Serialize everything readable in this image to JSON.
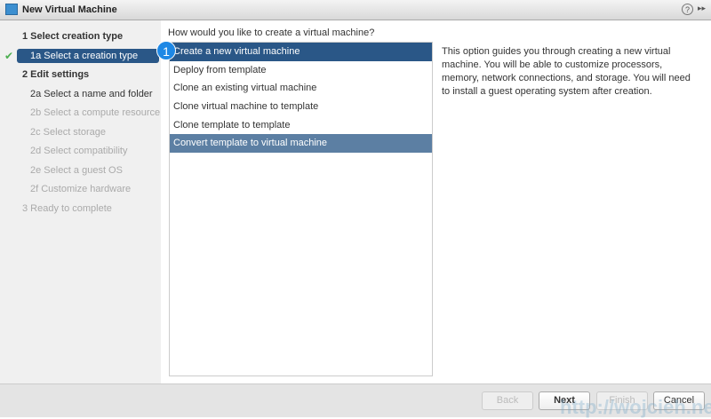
{
  "window": {
    "title": "New Virtual Machine",
    "help": "?",
    "expand": "▸▸"
  },
  "steps": [
    {
      "label": "1  Select creation type",
      "state": "header"
    },
    {
      "label": "1a  Select a creation type",
      "state": "active"
    },
    {
      "label": "2  Edit settings",
      "state": "header"
    },
    {
      "label": "2a  Select a name and folder",
      "state": "enabled"
    },
    {
      "label": "2b  Select a compute resource",
      "state": "disabled"
    },
    {
      "label": "2c  Select storage",
      "state": "disabled"
    },
    {
      "label": "2d  Select compatibility",
      "state": "disabled"
    },
    {
      "label": "2e  Select a guest OS",
      "state": "disabled"
    },
    {
      "label": "2f  Customize hardware",
      "state": "disabled"
    },
    {
      "label": "3  Ready to complete",
      "state": "disabled"
    }
  ],
  "check": "✔",
  "main": {
    "question": "How would you like to create a virtual machine?",
    "options": [
      "Create a new virtual machine",
      "Deploy from template",
      "Clone an existing virtual machine",
      "Clone virtual machine to template",
      "Clone template to template",
      "Convert template to virtual machine"
    ],
    "selected": 0,
    "hovered": 5,
    "description": "This option guides you through creating a new virtual machine. You will be able to customize processors, memory, network connections, and storage. You will need to install a guest operating system after creation.",
    "badge": "1"
  },
  "footer": {
    "back": "Back",
    "next": "Next",
    "finish": "Finish",
    "cancel": "Cancel"
  },
  "watermark": "http://wojcieh.net",
  "colors": {
    "selected": "#2a5787",
    "hover": "#5c7fa3",
    "badge": "#1e88e5",
    "check": "#4caf50"
  }
}
